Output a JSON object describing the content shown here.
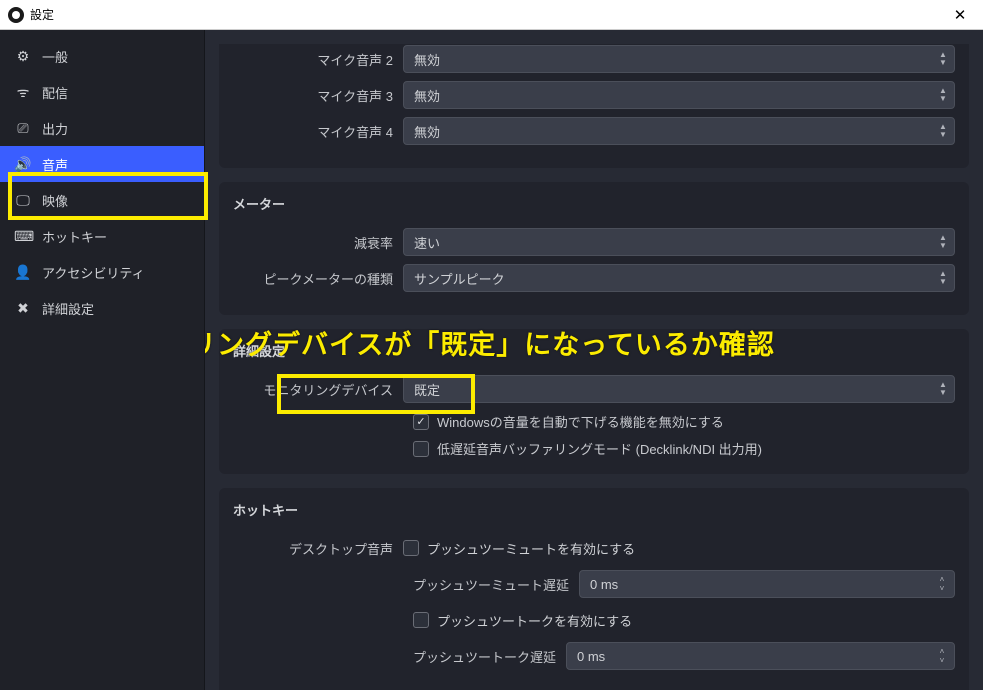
{
  "window": {
    "title": "設定"
  },
  "sidebar": {
    "items": [
      {
        "label": "一般"
      },
      {
        "label": "配信"
      },
      {
        "label": "出力"
      },
      {
        "label": "音声"
      },
      {
        "label": "映像"
      },
      {
        "label": "ホットキー"
      },
      {
        "label": "アクセシビリティ"
      },
      {
        "label": "詳細設定"
      }
    ]
  },
  "mic": {
    "row1_label": "マイク音声 2",
    "row1_value": "無効",
    "row2_label": "マイク音声 3",
    "row2_value": "無効",
    "row3_label": "マイク音声 4",
    "row3_value": "無効"
  },
  "meter": {
    "heading": "メーター",
    "decay_label": "減衰率",
    "decay_value": "速い",
    "peak_label": "ピークメーターの種類",
    "peak_value": "サンプルピーク"
  },
  "advanced": {
    "heading": "詳細設定",
    "monitor_label": "モニタリングデバイス",
    "monitor_value": "既定",
    "cb1_label": "Windowsの音量を自動で下げる機能を無効にする",
    "cb2_label": "低遅延音声バッファリングモード (Decklink/NDI 出力用)"
  },
  "hotkey": {
    "heading": "ホットキー",
    "desktop_label": "デスクトップ音声",
    "cb_ptm": "プッシュツーミュートを有効にする",
    "ptm_delay_label": "プッシュツーミュート遅延",
    "ptm_delay_value": "0 ms",
    "cb_ptt": "プッシュツートークを有効にする",
    "ptt_delay_label": "プッシュツートーク遅延",
    "ptt_delay_value": "0 ms"
  },
  "annotation": {
    "text": "モニタリングデバイスが「既定」になっているか確認"
  }
}
